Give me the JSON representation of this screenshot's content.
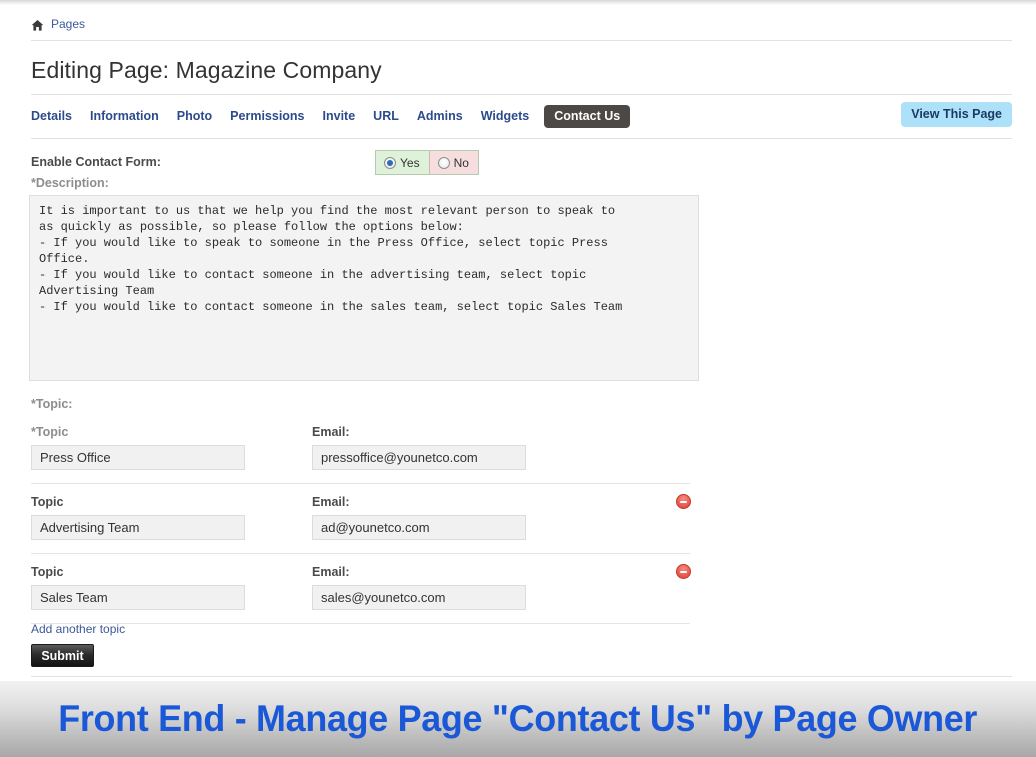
{
  "breadcrumb": {
    "home_icon": "home-icon",
    "label": "Pages"
  },
  "header": {
    "title": "Editing Page: Magazine Company",
    "view_page_label": "View This Page"
  },
  "tabs": [
    {
      "label": "Details",
      "active": false
    },
    {
      "label": "Information",
      "active": false
    },
    {
      "label": "Photo",
      "active": false
    },
    {
      "label": "Permissions",
      "active": false
    },
    {
      "label": "Invite",
      "active": false
    },
    {
      "label": "URL",
      "active": false
    },
    {
      "label": "Admins",
      "active": false
    },
    {
      "label": "Widgets",
      "active": false
    },
    {
      "label": "Contact Us",
      "active": true
    }
  ],
  "form": {
    "enable_contact_form_label": "Enable Contact Form:",
    "toggle": {
      "yes_label": "Yes",
      "no_label": "No",
      "selected": "Yes"
    },
    "description_label": "*Description:",
    "description_value": "It is important to us that we help you find the most relevant person to speak to\nas quickly as possible, so please follow the options below:\n- If you would like to speak to someone in the Press Office, select topic Press\nOffice.\n- If you would like to contact someone in the advertising team, select topic\nAdvertising Team\n- If you would like to contact someone in the sales team, select topic Sales Team",
    "topic_section_label": "*Topic:",
    "topics": [
      {
        "topic_label": "*Topic",
        "email_label": "Email:",
        "topic_value": "Press Office",
        "email_value": "pressoffice@younetco.com",
        "removable": false
      },
      {
        "topic_label": "Topic",
        "email_label": "Email:",
        "topic_value": "Advertising Team",
        "email_value": "ad@younetco.com",
        "removable": true
      },
      {
        "topic_label": "Topic",
        "email_label": "Email:",
        "topic_value": "Sales Team",
        "email_value": "sales@younetco.com",
        "removable": true
      }
    ],
    "add_topic_label": "Add another topic",
    "submit_label": "Submit"
  },
  "caption": {
    "text": "Front End - Manage Page \"Contact Us\" by Page Owner"
  },
  "colors": {
    "tab_link": "#2c4a8c",
    "active_tab_bg": "#4c4846",
    "view_page_bg": "#ade1f9",
    "yes_bg": "#ddf2d8",
    "no_bg": "#f7dede",
    "delete_icon": "#e8524a",
    "caption_text": "#1a58d8"
  }
}
